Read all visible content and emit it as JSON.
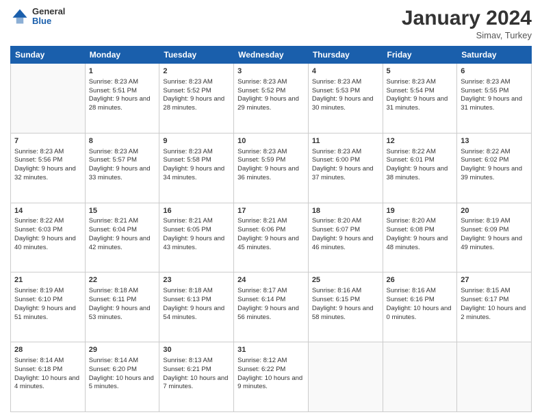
{
  "header": {
    "logo": {
      "general": "General",
      "blue": "Blue"
    },
    "title": "January 2024",
    "subtitle": "Simav, Turkey"
  },
  "days_of_week": [
    "Sunday",
    "Monday",
    "Tuesday",
    "Wednesday",
    "Thursday",
    "Friday",
    "Saturday"
  ],
  "weeks": [
    [
      null,
      {
        "day": 1,
        "sunrise": "Sunrise: 8:23 AM",
        "sunset": "Sunset: 5:51 PM",
        "daylight": "Daylight: 9 hours and 28 minutes."
      },
      {
        "day": 2,
        "sunrise": "Sunrise: 8:23 AM",
        "sunset": "Sunset: 5:52 PM",
        "daylight": "Daylight: 9 hours and 28 minutes."
      },
      {
        "day": 3,
        "sunrise": "Sunrise: 8:23 AM",
        "sunset": "Sunset: 5:52 PM",
        "daylight": "Daylight: 9 hours and 29 minutes."
      },
      {
        "day": 4,
        "sunrise": "Sunrise: 8:23 AM",
        "sunset": "Sunset: 5:53 PM",
        "daylight": "Daylight: 9 hours and 30 minutes."
      },
      {
        "day": 5,
        "sunrise": "Sunrise: 8:23 AM",
        "sunset": "Sunset: 5:54 PM",
        "daylight": "Daylight: 9 hours and 31 minutes."
      },
      {
        "day": 6,
        "sunrise": "Sunrise: 8:23 AM",
        "sunset": "Sunset: 5:55 PM",
        "daylight": "Daylight: 9 hours and 31 minutes."
      }
    ],
    [
      {
        "day": 7,
        "sunrise": "Sunrise: 8:23 AM",
        "sunset": "Sunset: 5:56 PM",
        "daylight": "Daylight: 9 hours and 32 minutes."
      },
      {
        "day": 8,
        "sunrise": "Sunrise: 8:23 AM",
        "sunset": "Sunset: 5:57 PM",
        "daylight": "Daylight: 9 hours and 33 minutes."
      },
      {
        "day": 9,
        "sunrise": "Sunrise: 8:23 AM",
        "sunset": "Sunset: 5:58 PM",
        "daylight": "Daylight: 9 hours and 34 minutes."
      },
      {
        "day": 10,
        "sunrise": "Sunrise: 8:23 AM",
        "sunset": "Sunset: 5:59 PM",
        "daylight": "Daylight: 9 hours and 36 minutes."
      },
      {
        "day": 11,
        "sunrise": "Sunrise: 8:23 AM",
        "sunset": "Sunset: 6:00 PM",
        "daylight": "Daylight: 9 hours and 37 minutes."
      },
      {
        "day": 12,
        "sunrise": "Sunrise: 8:22 AM",
        "sunset": "Sunset: 6:01 PM",
        "daylight": "Daylight: 9 hours and 38 minutes."
      },
      {
        "day": 13,
        "sunrise": "Sunrise: 8:22 AM",
        "sunset": "Sunset: 6:02 PM",
        "daylight": "Daylight: 9 hours and 39 minutes."
      }
    ],
    [
      {
        "day": 14,
        "sunrise": "Sunrise: 8:22 AM",
        "sunset": "Sunset: 6:03 PM",
        "daylight": "Daylight: 9 hours and 40 minutes."
      },
      {
        "day": 15,
        "sunrise": "Sunrise: 8:21 AM",
        "sunset": "Sunset: 6:04 PM",
        "daylight": "Daylight: 9 hours and 42 minutes."
      },
      {
        "day": 16,
        "sunrise": "Sunrise: 8:21 AM",
        "sunset": "Sunset: 6:05 PM",
        "daylight": "Daylight: 9 hours and 43 minutes."
      },
      {
        "day": 17,
        "sunrise": "Sunrise: 8:21 AM",
        "sunset": "Sunset: 6:06 PM",
        "daylight": "Daylight: 9 hours and 45 minutes."
      },
      {
        "day": 18,
        "sunrise": "Sunrise: 8:20 AM",
        "sunset": "Sunset: 6:07 PM",
        "daylight": "Daylight: 9 hours and 46 minutes."
      },
      {
        "day": 19,
        "sunrise": "Sunrise: 8:20 AM",
        "sunset": "Sunset: 6:08 PM",
        "daylight": "Daylight: 9 hours and 48 minutes."
      },
      {
        "day": 20,
        "sunrise": "Sunrise: 8:19 AM",
        "sunset": "Sunset: 6:09 PM",
        "daylight": "Daylight: 9 hours and 49 minutes."
      }
    ],
    [
      {
        "day": 21,
        "sunrise": "Sunrise: 8:19 AM",
        "sunset": "Sunset: 6:10 PM",
        "daylight": "Daylight: 9 hours and 51 minutes."
      },
      {
        "day": 22,
        "sunrise": "Sunrise: 8:18 AM",
        "sunset": "Sunset: 6:11 PM",
        "daylight": "Daylight: 9 hours and 53 minutes."
      },
      {
        "day": 23,
        "sunrise": "Sunrise: 8:18 AM",
        "sunset": "Sunset: 6:13 PM",
        "daylight": "Daylight: 9 hours and 54 minutes."
      },
      {
        "day": 24,
        "sunrise": "Sunrise: 8:17 AM",
        "sunset": "Sunset: 6:14 PM",
        "daylight": "Daylight: 9 hours and 56 minutes."
      },
      {
        "day": 25,
        "sunrise": "Sunrise: 8:16 AM",
        "sunset": "Sunset: 6:15 PM",
        "daylight": "Daylight: 9 hours and 58 minutes."
      },
      {
        "day": 26,
        "sunrise": "Sunrise: 8:16 AM",
        "sunset": "Sunset: 6:16 PM",
        "daylight": "Daylight: 10 hours and 0 minutes."
      },
      {
        "day": 27,
        "sunrise": "Sunrise: 8:15 AM",
        "sunset": "Sunset: 6:17 PM",
        "daylight": "Daylight: 10 hours and 2 minutes."
      }
    ],
    [
      {
        "day": 28,
        "sunrise": "Sunrise: 8:14 AM",
        "sunset": "Sunset: 6:18 PM",
        "daylight": "Daylight: 10 hours and 4 minutes."
      },
      {
        "day": 29,
        "sunrise": "Sunrise: 8:14 AM",
        "sunset": "Sunset: 6:20 PM",
        "daylight": "Daylight: 10 hours and 5 minutes."
      },
      {
        "day": 30,
        "sunrise": "Sunrise: 8:13 AM",
        "sunset": "Sunset: 6:21 PM",
        "daylight": "Daylight: 10 hours and 7 minutes."
      },
      {
        "day": 31,
        "sunrise": "Sunrise: 8:12 AM",
        "sunset": "Sunset: 6:22 PM",
        "daylight": "Daylight: 10 hours and 9 minutes."
      },
      null,
      null,
      null
    ]
  ]
}
